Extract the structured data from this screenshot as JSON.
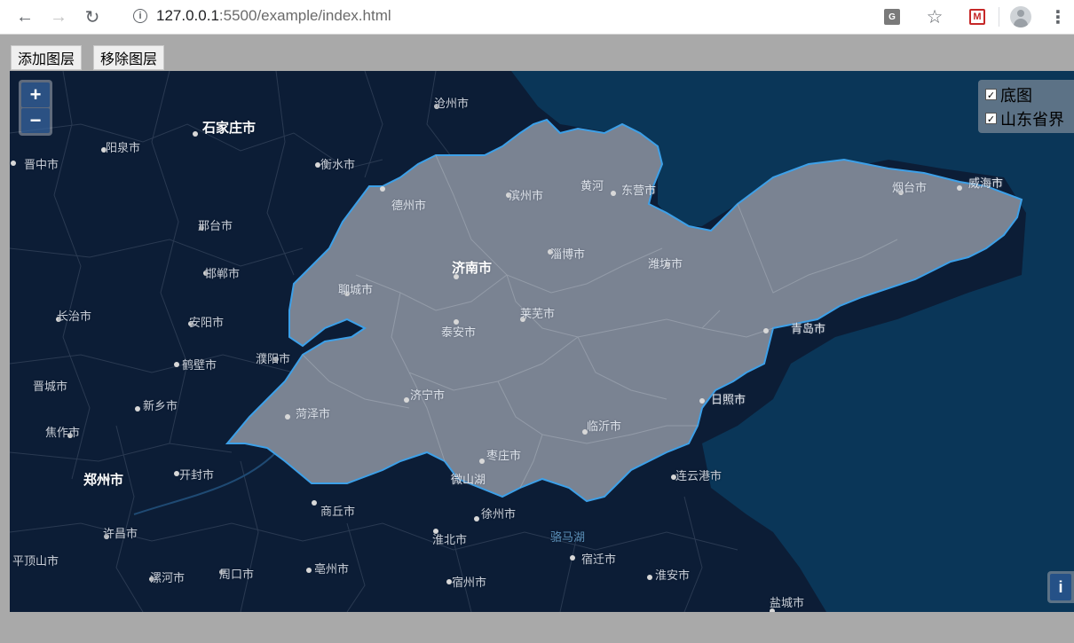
{
  "browser": {
    "url_host": "127.0.0.1",
    "url_rest": ":5500/example/index.html"
  },
  "buttons": {
    "add_layer": "添加图层",
    "remove_layer": "移除图层"
  },
  "map": {
    "zoom_in": "+",
    "zoom_out": "−",
    "attribution": "i",
    "layers": [
      {
        "label": "底图",
        "checked": true
      },
      {
        "label": "山东省界",
        "checked": true
      }
    ],
    "cities": [
      {
        "name": "石家庄市",
        "major": true
      },
      {
        "name": "沧州市"
      },
      {
        "name": "阳泉市"
      },
      {
        "name": "衡水市"
      },
      {
        "name": "晋中市"
      },
      {
        "name": "邢台市"
      },
      {
        "name": "邯郸市"
      },
      {
        "name": "长治市"
      },
      {
        "name": "安阳市"
      },
      {
        "name": "鹤壁市"
      },
      {
        "name": "濮阳市"
      },
      {
        "name": "晋城市"
      },
      {
        "name": "新乡市"
      },
      {
        "name": "焦作市"
      },
      {
        "name": "郑州市",
        "major": true
      },
      {
        "name": "开封市"
      },
      {
        "name": "商丘市"
      },
      {
        "name": "许昌市"
      },
      {
        "name": "平顶山市"
      },
      {
        "name": "漯河市"
      },
      {
        "name": "周口市"
      },
      {
        "name": "亳州市"
      },
      {
        "name": "淮北市"
      },
      {
        "name": "宿州市"
      },
      {
        "name": "徐州市"
      },
      {
        "name": "骆马湖"
      },
      {
        "name": "宿迁市"
      },
      {
        "name": "淮安市"
      },
      {
        "name": "连云港市"
      },
      {
        "name": "盐城市"
      },
      {
        "name": "德州市"
      },
      {
        "name": "滨州市"
      },
      {
        "name": "黄河"
      },
      {
        "name": "东营市"
      },
      {
        "name": "烟台市"
      },
      {
        "name": "威海市"
      },
      {
        "name": "济南市",
        "major": true
      },
      {
        "name": "淄博市"
      },
      {
        "name": "潍坊市"
      },
      {
        "name": "聊城市"
      },
      {
        "name": "莱芜市"
      },
      {
        "name": "泰安市"
      },
      {
        "name": "青岛市"
      },
      {
        "name": "济宁市"
      },
      {
        "name": "菏泽市"
      },
      {
        "name": "临沂市"
      },
      {
        "name": "日照市"
      },
      {
        "name": "枣庄市"
      },
      {
        "name": "微山湖"
      }
    ]
  }
}
